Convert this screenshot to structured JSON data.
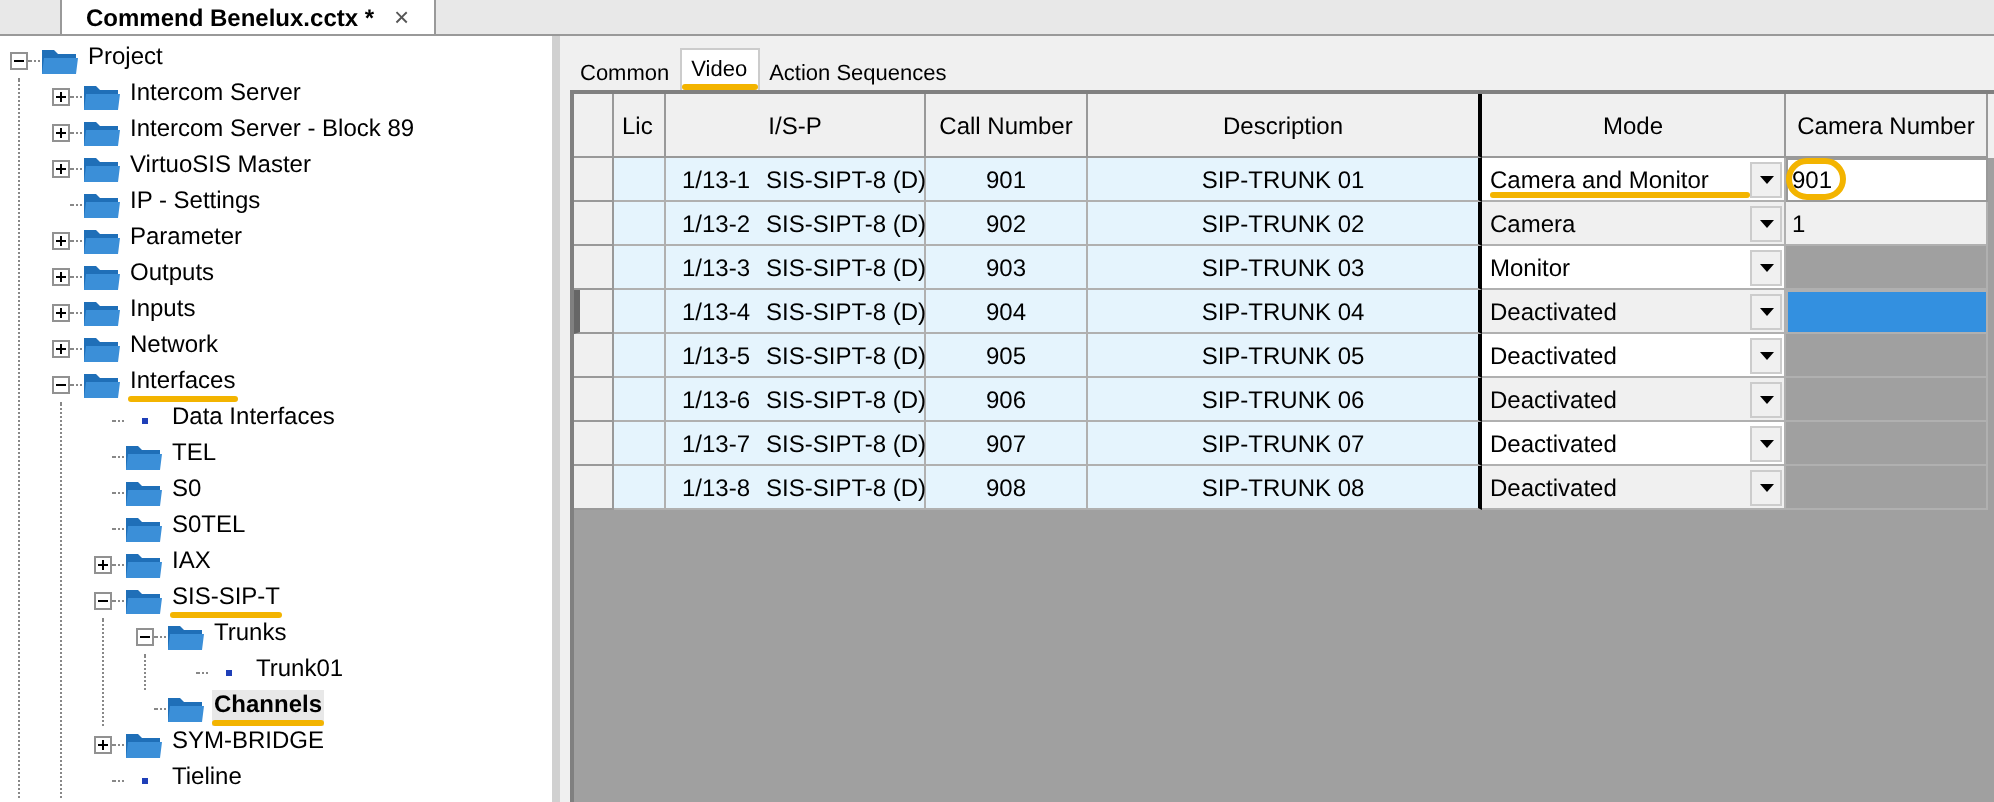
{
  "document_tab": {
    "title": "Commend Benelux.cctx *",
    "close": "×"
  },
  "tree": [
    {
      "label": "Project",
      "kind": "folder",
      "expanded": true,
      "bold": false,
      "underlined": false,
      "children": [
        {
          "label": "Intercom Server",
          "kind": "folder",
          "expanded": false,
          "bold": false,
          "underlined": false
        },
        {
          "label": "Intercom Server - Block 89",
          "kind": "folder",
          "expanded": false,
          "bold": false,
          "underlined": false
        },
        {
          "label": "VirtuoSIS Master",
          "kind": "folder",
          "expanded": false,
          "bold": false,
          "underlined": false
        },
        {
          "label": "IP - Settings",
          "kind": "folder",
          "bold": false,
          "underlined": false
        },
        {
          "label": "Parameter",
          "kind": "folder",
          "expanded": false,
          "bold": false,
          "underlined": false
        },
        {
          "label": "Outputs",
          "kind": "folder",
          "expanded": false,
          "bold": false,
          "underlined": false
        },
        {
          "label": "Inputs",
          "kind": "folder",
          "expanded": false,
          "bold": false,
          "underlined": false
        },
        {
          "label": "Network",
          "kind": "folder",
          "expanded": false,
          "bold": false,
          "underlined": false
        },
        {
          "label": "Interfaces",
          "kind": "folder",
          "expanded": true,
          "bold": false,
          "underlined": true,
          "children": [
            {
              "label": "Data Interfaces",
              "kind": "leaf",
              "bold": false,
              "underlined": false
            },
            {
              "label": "TEL",
              "kind": "folder",
              "bold": false,
              "underlined": false
            },
            {
              "label": "S0",
              "kind": "folder",
              "bold": false,
              "underlined": false
            },
            {
              "label": "S0TEL",
              "kind": "folder",
              "bold": false,
              "underlined": false
            },
            {
              "label": "IAX",
              "kind": "folder",
              "expanded": false,
              "bold": false,
              "underlined": false
            },
            {
              "label": "SIS-SIP-T",
              "kind": "folder",
              "expanded": true,
              "bold": false,
              "underlined": true,
              "children": [
                {
                  "label": "Trunks",
                  "kind": "folder",
                  "expanded": true,
                  "bold": false,
                  "underlined": false,
                  "children": [
                    {
                      "label": "Trunk01",
                      "kind": "leaf",
                      "bold": false,
                      "underlined": false
                    }
                  ]
                },
                {
                  "label": "Channels",
                  "kind": "folder",
                  "bold": true,
                  "underlined": true
                }
              ]
            },
            {
              "label": "SYM-BRIDGE",
              "kind": "folder",
              "expanded": false,
              "bold": false,
              "underlined": false
            },
            {
              "label": "Tieline",
              "kind": "leaf",
              "bold": false,
              "underlined": false
            }
          ]
        }
      ]
    }
  ],
  "tabs": [
    {
      "label": "Common",
      "selected": false,
      "underlined": false
    },
    {
      "label": "Video",
      "selected": true,
      "underlined": true
    },
    {
      "label": "Action Sequences",
      "selected": false,
      "underlined": false
    }
  ],
  "table": {
    "columns": [
      "Lic",
      "I/S-P",
      "Call Number",
      "Description",
      "Mode",
      "Camera Number"
    ],
    "rows": [
      {
        "current": false,
        "port": "1/13-1",
        "module": "SIS-SIPT-8 (D)",
        "call_number": "901",
        "description": "SIP-TRUNK 01",
        "mode": "Camera and Monitor",
        "mode_underlined": true,
        "camera": "901",
        "camera_editing": true,
        "camera_selected": false,
        "camera_disabled": false,
        "camera_circled": true
      },
      {
        "current": false,
        "port": "1/13-2",
        "module": "SIS-SIPT-8 (D)",
        "call_number": "902",
        "description": "SIP-TRUNK 02",
        "mode": "Camera",
        "mode_underlined": false,
        "camera": "1",
        "camera_editing": false,
        "camera_selected": false,
        "camera_disabled": false,
        "camera_circled": false
      },
      {
        "current": false,
        "port": "1/13-3",
        "module": "SIS-SIPT-8 (D)",
        "call_number": "903",
        "description": "SIP-TRUNK 03",
        "mode": "Monitor",
        "mode_underlined": false,
        "camera_editing": false,
        "camera_selected": false,
        "camera_disabled": true,
        "camera_circled": false
      },
      {
        "current": true,
        "port": "1/13-4",
        "module": "SIS-SIPT-8 (D)",
        "call_number": "904",
        "description": "SIP-TRUNK 04",
        "mode": "Deactivated",
        "mode_underlined": false,
        "camera_editing": false,
        "camera_selected": true,
        "camera_disabled": false,
        "camera_circled": false
      },
      {
        "current": false,
        "port": "1/13-5",
        "module": "SIS-SIPT-8 (D)",
        "call_number": "905",
        "description": "SIP-TRUNK 05",
        "mode": "Deactivated",
        "mode_underlined": false,
        "camera_editing": false,
        "camera_selected": false,
        "camera_disabled": true,
        "camera_circled": false
      },
      {
        "current": false,
        "port": "1/13-6",
        "module": "SIS-SIPT-8 (D)",
        "call_number": "906",
        "description": "SIP-TRUNK 06",
        "mode": "Deactivated",
        "mode_underlined": false,
        "camera_editing": false,
        "camera_selected": false,
        "camera_disabled": true,
        "camera_circled": false
      },
      {
        "current": false,
        "port": "1/13-7",
        "module": "SIS-SIPT-8 (D)",
        "call_number": "907",
        "description": "SIP-TRUNK 07",
        "mode": "Deactivated",
        "mode_underlined": false,
        "camera_editing": false,
        "camera_selected": false,
        "camera_disabled": true,
        "camera_circled": false
      },
      {
        "current": false,
        "port": "1/13-8",
        "module": "SIS-SIPT-8 (D)",
        "call_number": "908",
        "description": "SIP-TRUNK 08",
        "mode": "Deactivated",
        "mode_underlined": false,
        "camera_editing": false,
        "camera_selected": false,
        "camera_disabled": true,
        "camera_circled": false
      }
    ]
  }
}
